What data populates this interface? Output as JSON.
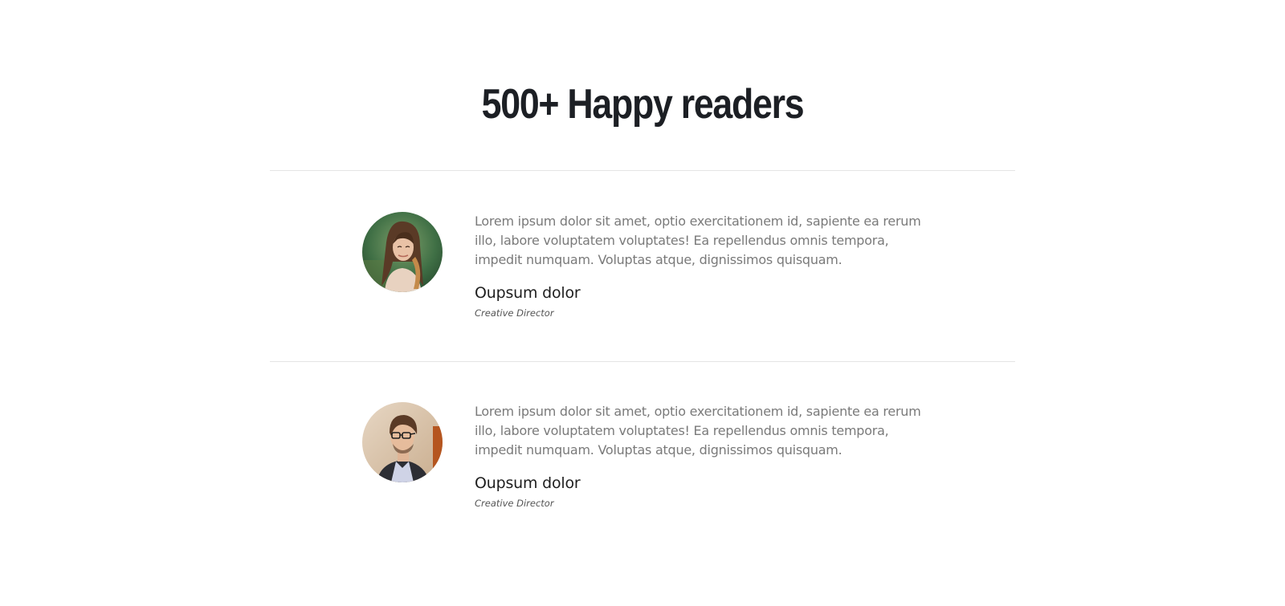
{
  "section": {
    "title": "500+ Happy readers"
  },
  "testimonials": [
    {
      "avatar_icon": "woman-portrait",
      "quote": "Lorem ipsum dolor sit amet, optio exercitationem id, sapiente ea rerum illo, labore voluptatem voluptates! Ea repellendus omnis tempora, impedit numquam. Voluptas atque, dignissimos quisquam.",
      "name": "Oupsum dolor",
      "role": "Creative Director"
    },
    {
      "avatar_icon": "man-portrait",
      "quote": "Lorem ipsum dolor sit amet, optio exercitationem id, sapiente ea rerum illo, labore voluptatem voluptates! Ea repellendus omnis tempora, impedit numquam. Voluptas atque, dignissimos quisquam.",
      "name": "Oupsum dolor",
      "role": "Creative Director"
    }
  ],
  "colors": {
    "title": "#1c1f24",
    "quote_text": "#7a7a7a",
    "divider": "#e5e5e5"
  }
}
